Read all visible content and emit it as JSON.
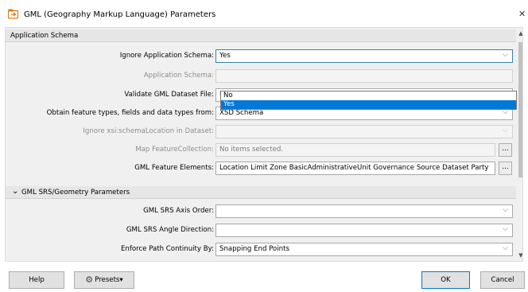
{
  "window": {
    "title": "GML (Geography Markup Language) Parameters",
    "close_icon": "✕"
  },
  "sections": {
    "app_schema": {
      "label": "Application Schema"
    },
    "srs": {
      "label": "GML SRS/Geometry Parameters",
      "chevron": "⌄"
    }
  },
  "fields": {
    "ignore_schema": {
      "label": "Ignore Application Schema:",
      "value": "Yes"
    },
    "app_schema": {
      "label": "Application Schema:",
      "value": ""
    },
    "validate": {
      "label": "Validate GML Dataset File:",
      "value": "No"
    },
    "obtain": {
      "label": "Obtain feature types, fields and data types from:",
      "value": "XSD Schema"
    },
    "ignore_xsi": {
      "label": "Ignore xsi:schemaLocation in Dataset:",
      "value": ""
    },
    "map_fc": {
      "label": "Map FeatureCollection:",
      "value": "No items selected."
    },
    "feature_elements": {
      "label": "GML Feature Elements:",
      "value": "Location Limit Zone BasicAdministrativeUnit Governance Source Dataset Party"
    },
    "axis_order": {
      "label": "GML SRS Axis Order:",
      "value": ""
    },
    "angle_dir": {
      "label": "GML SRS Angle Direction:",
      "value": ""
    },
    "path_cont": {
      "label": "Enforce Path Continuity By:",
      "value": "Snapping End Points"
    }
  },
  "dropdown": {
    "options": [
      "No",
      "Yes"
    ],
    "selected": "Yes"
  },
  "glyphs": {
    "dropdown_arrow": "⌵",
    "ellipsis": "...",
    "up": "▲",
    "down": "▼"
  },
  "buttons": {
    "help": "Help",
    "presets": "Presets▾",
    "ok": "OK",
    "cancel": "Cancel"
  }
}
